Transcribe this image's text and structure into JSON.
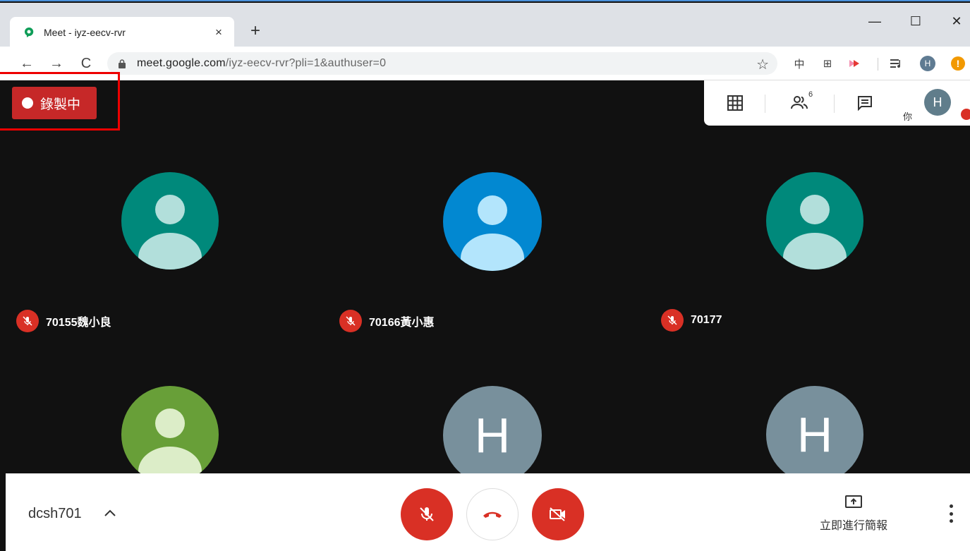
{
  "browser": {
    "tab_title": "Meet - iyz-eecv-rvr",
    "tab_close": "×",
    "new_tab": "+",
    "window_controls": {
      "minimize": "—",
      "maximize": "☐",
      "close": "✕"
    },
    "nav": {
      "back": "←",
      "forward": "→",
      "reload": "C"
    },
    "url_host": "meet.google.com",
    "url_path": "/iyz-eecv-rvr?pli=1&authuser=0",
    "star": "☆",
    "extensions": {
      "zh": "中",
      "grid": "⊞",
      "profile_initial": "H",
      "warn": "!"
    }
  },
  "recording": {
    "label": "錄製中"
  },
  "top_panel": {
    "participant_count": "6",
    "self_label": "你",
    "self_initial": "H"
  },
  "participants": [
    {
      "name": "70155魏小良",
      "avatar_type": "person",
      "color": "#00897b",
      "muted": true
    },
    {
      "name": "70166黃小惠",
      "avatar_type": "person",
      "color": "#0288d1",
      "muted": true
    },
    {
      "name": "70177",
      "avatar_type": "person",
      "color": "#00897b",
      "muted": true
    },
    {
      "name": "",
      "avatar_type": "person",
      "color": "#689f38",
      "muted": false
    },
    {
      "name": "",
      "avatar_type": "letter",
      "initial": "H",
      "color": "#78909c",
      "muted": false
    },
    {
      "name": "",
      "avatar_type": "letter",
      "initial": "H",
      "color": "#78909c",
      "muted": false
    }
  ],
  "bottom_bar": {
    "meeting_code": "dcsh701",
    "present_label": "立即進行簡報"
  },
  "colors": {
    "accent_red": "#d93025",
    "recording_red": "#c62828"
  }
}
